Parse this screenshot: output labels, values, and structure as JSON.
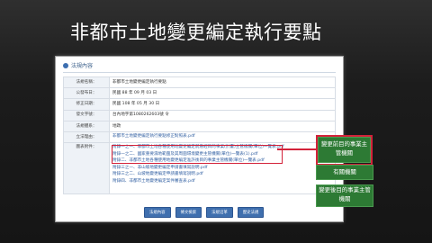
{
  "slide": {
    "title": "非都市土地變更編定執行要點"
  },
  "panel": {
    "title": "法規內容"
  },
  "rows": [
    {
      "label": "法規名稱：",
      "value": "非都市土地變更編定執行要點"
    },
    {
      "label": "公發布日：",
      "value": "民國 88 年 09 月 03 日"
    },
    {
      "label": "修正日期：",
      "value": "民國 108 年 05 月 30 日"
    },
    {
      "label": "發文字號：",
      "value": "台內地字第1080262603號 令"
    },
    {
      "label": "法規體系：",
      "value": "地政"
    },
    {
      "label": "立法理由：",
      "value": "非都市土地變更編定執行要點修正對照表.pdf"
    }
  ],
  "attachments": {
    "label": "圖表附件：",
    "items": [
      "附錄一之一、非都市土地各種使用地變更編定前應經目的事業(計畫)主管機關(單位)一覽表.pdf",
      "附錄一之二、國家重要濕地範圍及其周圍環境變更主管機關(單位)一覽表(1).pdf",
      "附錄二、非都市土地各種使用地變更編定准許後目的事業主管機關(單位)一覽表.pdf",
      "附錄三之一、非山坡地變更編定申請書填寫說明.pdf",
      "附錄三之二、山坡地變更編定申請書填寫說明.pdf",
      "附錄四、非都市土地變更編定案件審查表.pdf"
    ]
  },
  "buttons": [
    "法規內容",
    "條文檢索",
    "法規沿革",
    "歷史法規"
  ],
  "callouts": [
    "變更前目的事業主管機關",
    "有關機關",
    "變更後目的事業主管機關"
  ]
}
